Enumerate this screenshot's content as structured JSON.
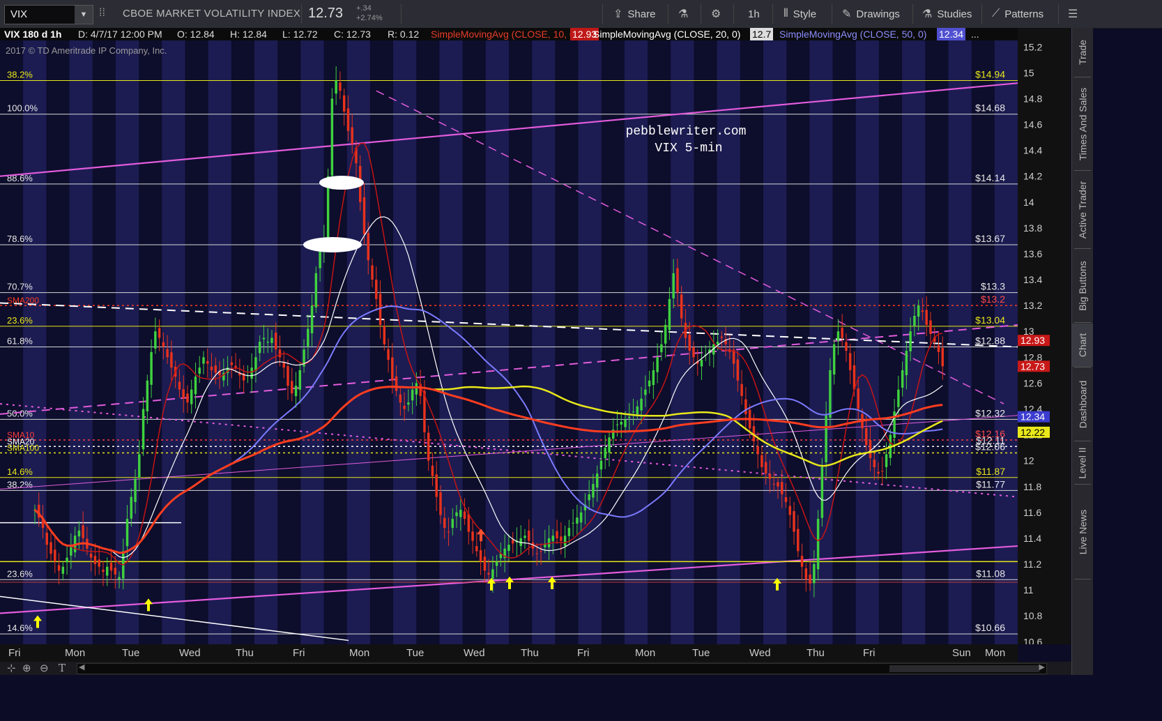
{
  "header": {
    "symbol": "VIX",
    "instrument_name": "CBOE MARKET VOLATILITY INDEX",
    "price": "12.73",
    "change": "+.34",
    "change_pct": "+2.74%",
    "buttons": {
      "share": "Share",
      "timeframe": "1h",
      "style": "Style",
      "drawings": "Drawings",
      "studies": "Studies",
      "patterns": "Patterns"
    }
  },
  "study_bar": {
    "info": "VIX 180 d 1h",
    "date": "D: 4/7/17 12:00 PM",
    "open": "O: 12.84",
    "high": "H: 12.84",
    "low": "L: 12.72",
    "close": "C: 12.73",
    "range": "R: 0.12",
    "sma10_label": "SimpleMovingAvg (CLOSE, 10, 0)",
    "sma10_val": "12.93",
    "sma20_label": "SimpleMovingAvg (CLOSE, 20, 0)",
    "sma20_val": "12.7",
    "sma50_label": "SimpleMovingAvg (CLOSE, 50, 0)",
    "sma50_val": "12.34",
    "more": "..."
  },
  "chart_overlay": {
    "copyright": "2017 © TD Ameritrade IP Company, Inc.",
    "watermark_line1": "pebblewriter.com",
    "watermark_line2": "VIX 5-min"
  },
  "colors": {
    "bg_dark": "#0d0d2c",
    "bg_light": "#1c1c52",
    "up": "#3fd23f",
    "down": "#e8321c",
    "magenta": "#e35cdc",
    "yellow": "#e8e81a",
    "sma20": "#ffffff",
    "sma50": "#7b7bff",
    "sma10": "#c41414",
    "sma200": "#ff3d1f"
  },
  "chart_data": {
    "type": "candlestick",
    "symbol": "VIX",
    "interval": "1h",
    "x_labels": [
      "Fri",
      "Mon",
      "Tue",
      "Wed",
      "Thu",
      "Fri",
      "Mon",
      "Tue",
      "Wed",
      "Thu",
      "Fri",
      "Mon",
      "Tue",
      "Wed",
      "Thu",
      "Fri",
      "Sun",
      "Mon"
    ],
    "y_range": [
      10.58,
      15.25
    ],
    "y_ticks": [
      "15.2",
      "15",
      "14.8",
      "14.6",
      "14.4",
      "14.2",
      "14",
      "13.8",
      "13.6",
      "13.4",
      "13.2",
      "13",
      "12.8",
      "12.6",
      "12.4",
      "12.2",
      "12",
      "11.8",
      "11.6",
      "11.4",
      "11.2",
      "11",
      "10.8",
      "10.6"
    ],
    "last_ohlc": {
      "open": 12.84,
      "high": 12.84,
      "low": 12.72,
      "close": 12.73
    },
    "moving_averages": [
      {
        "name": "SMA10",
        "value": 12.93
      },
      {
        "name": "SMA20",
        "value": 12.7
      },
      {
        "name": "SMA50",
        "value": 12.34
      },
      {
        "name": "SMA100",
        "value": 12.22
      }
    ],
    "right_price_labels": [
      {
        "text": "$14.94",
        "value": 14.94
      },
      {
        "text": "$14.68",
        "value": 14.68
      },
      {
        "text": "$14.14",
        "value": 14.14
      },
      {
        "text": "$13.67",
        "value": 13.67
      },
      {
        "text": "$13.3",
        "value": 13.3
      },
      {
        "text": "$13.2",
        "value": 13.2
      },
      {
        "text": "$13.04",
        "value": 13.04
      },
      {
        "text": "$12.88",
        "value": 12.88
      },
      {
        "text": "$12.32",
        "value": 12.32
      },
      {
        "text": "$12.16",
        "value": 12.16
      },
      {
        "text": "$12.11",
        "value": 12.11
      },
      {
        "text": "$12.06",
        "value": 12.06
      },
      {
        "text": "$11.87",
        "value": 11.87
      },
      {
        "text": "$11.77",
        "value": 11.77
      },
      {
        "text": "$11.08",
        "value": 11.08
      },
      {
        "text": "$10.66",
        "value": 10.66
      }
    ],
    "fib_levels": [
      {
        "label": "38.2%",
        "value": 14.94
      },
      {
        "label": "100.0%",
        "value": 14.68
      },
      {
        "label": "88.6%",
        "value": 14.14
      },
      {
        "label": "78.6%",
        "value": 13.67
      },
      {
        "label": "70.7%",
        "value": 13.3
      },
      {
        "label": "23.6%",
        "value": 13.04
      },
      {
        "label": "61.8%",
        "value": 12.88
      },
      {
        "label": "50.0%",
        "value": 12.32
      },
      {
        "label": "14.6%",
        "value": 11.87
      },
      {
        "label": "38.2%",
        "value": 11.77
      },
      {
        "label": "23.6%",
        "value": 11.08
      },
      {
        "label": "14.6%",
        "value": 10.66
      }
    ],
    "ma_level_labels": [
      {
        "label": "SMA200",
        "value": 13.2
      },
      {
        "label": "SMA10",
        "value": 12.16
      },
      {
        "label": "SMA20",
        "value": 12.11
      },
      {
        "label": "SMA100",
        "value": 12.06
      }
    ],
    "axis_badges": [
      {
        "text": "12.93",
        "value": 12.93
      },
      {
        "text": "12.73",
        "value": 12.73
      },
      {
        "text": "12.34",
        "value": 12.34
      },
      {
        "text": "12.22",
        "value": 12.22
      }
    ],
    "closes": [
      11.62,
      11.56,
      11.48,
      11.35,
      11.28,
      11.22,
      11.15,
      11.18,
      11.25,
      11.33,
      11.42,
      11.46,
      11.4,
      11.32,
      11.25,
      11.2,
      11.18,
      11.14,
      11.18,
      11.15,
      11.12,
      11.1,
      11.3,
      11.55,
      11.72,
      11.86,
      12.05,
      12.4,
      12.62,
      12.84,
      13.0,
      12.95,
      12.88,
      12.8,
      12.72,
      12.65,
      12.55,
      12.48,
      12.45,
      12.55,
      12.65,
      12.72,
      12.8,
      12.75,
      12.7,
      12.68,
      12.66,
      12.68,
      12.72,
      12.74,
      12.72,
      12.66,
      12.62,
      12.66,
      12.72,
      12.8,
      12.92,
      12.95,
      12.92,
      12.95,
      12.86,
      12.8,
      12.72,
      12.58,
      12.52,
      12.58,
      12.7,
      12.86,
      13.02,
      13.2,
      13.45,
      13.62,
      13.72,
      14.2,
      14.8,
      14.94,
      14.86,
      14.7,
      14.55,
      14.45,
      14.3,
      14.0,
      13.75,
      13.55,
      13.4,
      13.25,
      13.05,
      12.9,
      12.78,
      12.62,
      12.54,
      12.45,
      12.4,
      12.45,
      12.55,
      12.6,
      12.5,
      12.22,
      12.0,
      11.88,
      11.72,
      11.58,
      11.48,
      11.45,
      11.55,
      11.6,
      11.62,
      11.55,
      11.45,
      11.38,
      11.3,
      11.22,
      11.15,
      11.12,
      11.16,
      11.22,
      11.28,
      11.32,
      11.35,
      11.36,
      11.38,
      11.4,
      11.42,
      11.38,
      11.32,
      11.28,
      11.3,
      11.36,
      11.4,
      11.42,
      11.4,
      11.38,
      11.42,
      11.48,
      11.52,
      11.56,
      11.6,
      11.66,
      11.74,
      11.82,
      11.9,
      12.0,
      12.1,
      12.18,
      12.24,
      12.28,
      12.3,
      12.32,
      12.34,
      12.38,
      12.42,
      12.48,
      12.55,
      12.62,
      12.7,
      12.8,
      12.9,
      13.05,
      13.25,
      13.45,
      13.3,
      13.1,
      12.95,
      12.85,
      12.8,
      12.75,
      12.78,
      12.82,
      12.86,
      12.9,
      12.92,
      12.95,
      12.9,
      12.84,
      12.75,
      12.62,
      12.5,
      12.36,
      12.25,
      12.15,
      12.05,
      11.95,
      11.9,
      11.86,
      11.82,
      11.8,
      11.74,
      11.68,
      11.58,
      11.45,
      11.3,
      11.18,
      11.08,
      11.05,
      11.2,
      11.55,
      11.95,
      12.35,
      12.7,
      12.9,
      13.0,
      12.95,
      12.85,
      12.7,
      12.55,
      12.4,
      12.25,
      12.12,
      12.02,
      11.95,
      11.9,
      11.92,
      12.05,
      12.2,
      12.38,
      12.55,
      12.7,
      12.85,
      13.0,
      13.12,
      13.2,
      13.15,
      13.05,
      12.98,
      12.92,
      12.84,
      12.73
    ]
  },
  "sidebar": {
    "tabs": [
      "Trade",
      "Times And Sales",
      "Active Trader",
      "Big Buttons",
      "Chart",
      "Dashboard",
      "Level II",
      "Live News"
    ]
  },
  "bottom": {
    "zoom_labels": [
      "⊕",
      "⊖",
      "T"
    ]
  }
}
